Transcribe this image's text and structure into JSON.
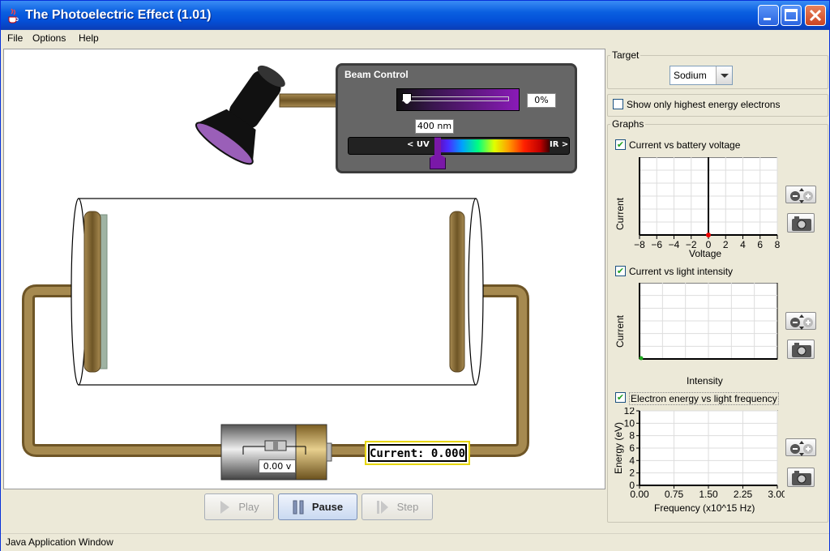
{
  "window": {
    "title": "The Photoelectric Effect (1.01)"
  },
  "menu": {
    "file": "File",
    "options": "Options",
    "help": "Help"
  },
  "beam": {
    "title": "Beam Control",
    "intensity": "0%",
    "wavelength": "400 nm",
    "uv": "< UV",
    "ir": "IR >"
  },
  "circuit": {
    "current": "Current: 0.000",
    "voltage": "0.00 v"
  },
  "controls": {
    "play": "Play",
    "pause": "Pause",
    "step": "Step"
  },
  "status": "Java Application Window",
  "panel": {
    "target_label": "Target",
    "target_value": "Sodium",
    "highest_energy_label": "Show only highest energy electrons",
    "highest_energy_checked": false,
    "graphs_label": "Graphs",
    "graph1": {
      "label": "Current vs battery voltage",
      "checked": true,
      "ylabel": "Current",
      "xlabel": "Voltage",
      "ticks": [
        "-8",
        "-6",
        "-4",
        "-2",
        "0",
        "2",
        "4",
        "6",
        "8"
      ]
    },
    "graph2": {
      "label": "Current vs light intensity",
      "checked": true,
      "ylabel": "Current",
      "xlabel": "Intensity"
    },
    "graph3": {
      "label": "Electron energy vs light frequency",
      "checked": true,
      "ylabel": "Energy (eV)",
      "xlabel": "Frequency (x10^15 Hz)",
      "yticks": [
        "12",
        "10",
        "8",
        "6",
        "4",
        "2",
        "0"
      ],
      "xticks": [
        "0.00",
        "0.75",
        "1.50",
        "2.25",
        "3.00"
      ]
    }
  },
  "colors": {
    "titlebar": "#0A5FE0",
    "beam": "#8a1ab8",
    "wire": "#8d7440",
    "current_box": "#e6d600"
  }
}
